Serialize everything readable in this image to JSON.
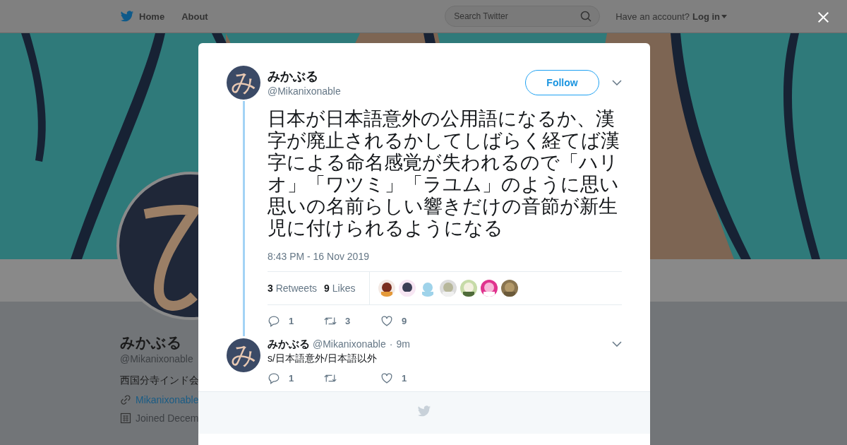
{
  "nav": {
    "items": [
      {
        "label": "Home",
        "kind": "home"
      },
      {
        "label": "About",
        "kind": "plain"
      }
    ],
    "search": {
      "placeholder": "Search Twitter"
    },
    "account_prompt": "Have an account?",
    "login": "Log in"
  },
  "profile": {
    "name": "みかぶる",
    "handle": "@Mikanixonable",
    "bio": "西国分寺インド会",
    "link": "Mikanixonable",
    "joined": "Joined Decem"
  },
  "tweet": {
    "author": {
      "name": "みかぶる",
      "handle": "@Mikanixonable",
      "avatar_glyph": "み"
    },
    "follow": "Follow",
    "text": "日本が日本語意外の公用語になるか、漢字が廃止されるかしてしばらく経てば漢字による命名感覚が失われるので「ハリオ」「ワツミ」「ラユム」のように思い思いの名前らしい響きだけの音節が新生児に付けられるようになる",
    "timestamp": "8:43 PM - 16 Nov 2019",
    "stats": [
      {
        "count": "3",
        "label": "Retweets"
      },
      {
        "count": "9",
        "label": "Likes"
      }
    ],
    "actions": [
      {
        "kind": "reply",
        "count": "1"
      },
      {
        "kind": "retweet",
        "count": "3"
      },
      {
        "kind": "like",
        "count": "9"
      }
    ]
  },
  "reply": {
    "name": "みかぶる",
    "handle": "@Mikanixonable",
    "separator": "·",
    "time": "9m",
    "avatar_glyph": "み",
    "text": "s/日本語意外/日本語以外",
    "actions": [
      {
        "kind": "reply",
        "count": "1"
      },
      {
        "kind": "retweet"
      },
      {
        "kind": "like",
        "count": "1"
      }
    ]
  }
}
